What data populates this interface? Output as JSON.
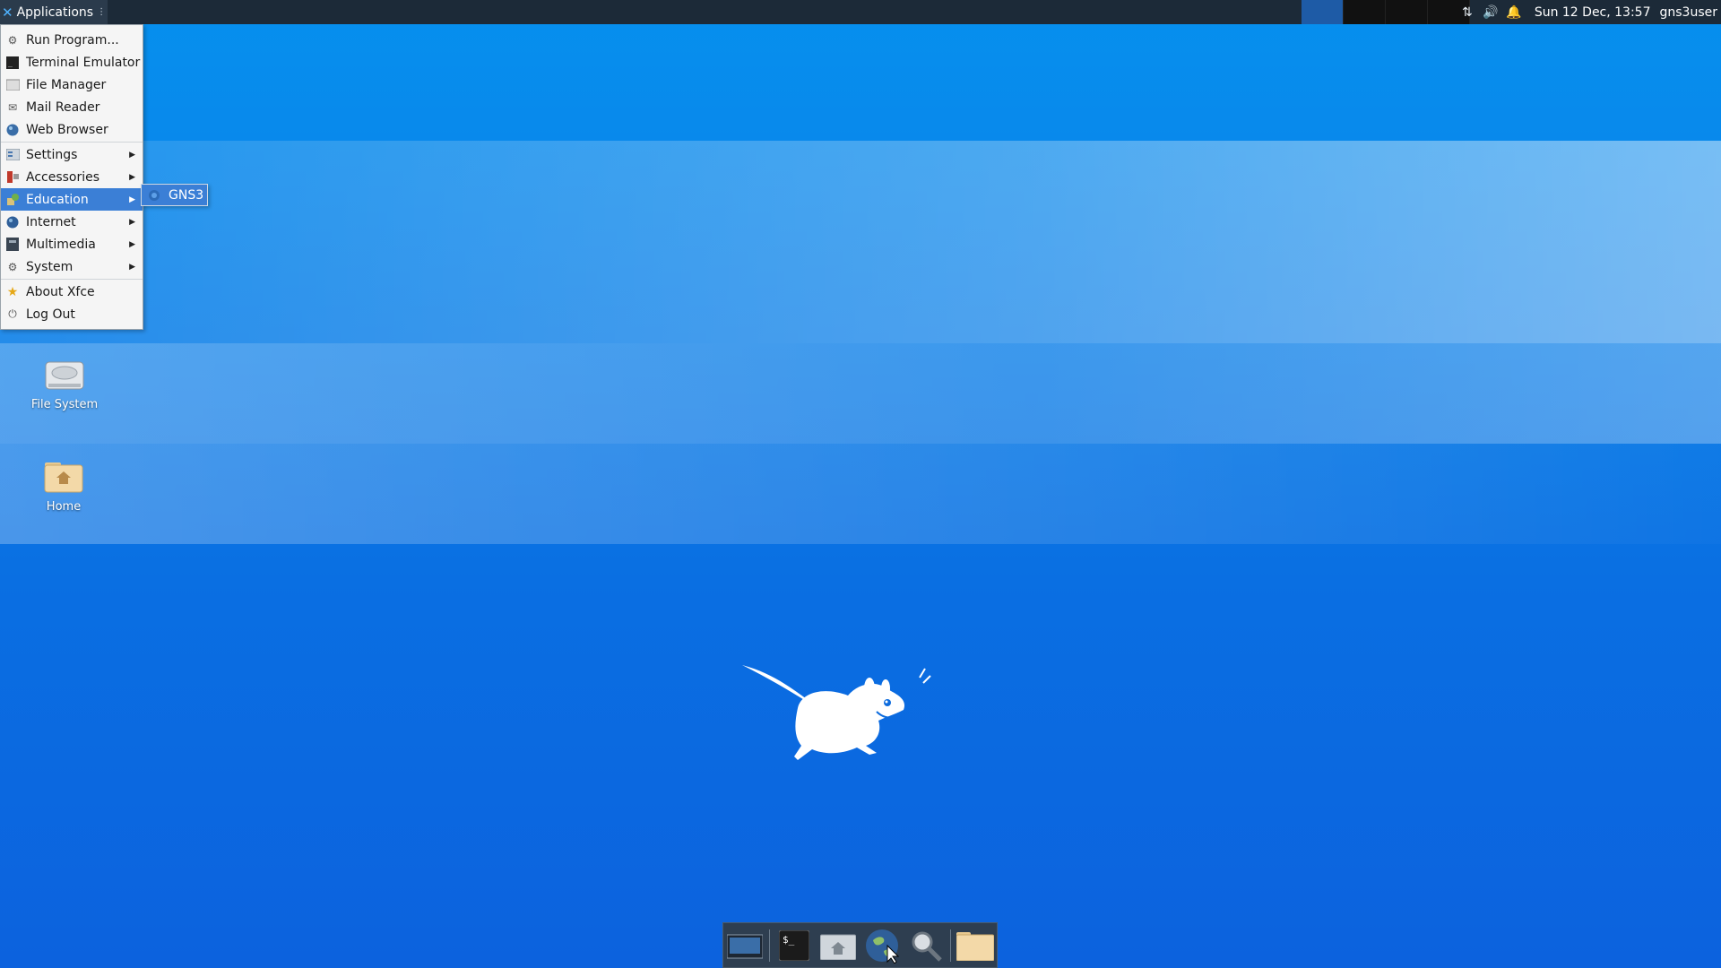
{
  "panel": {
    "apps_label": "Applications",
    "clock": "Sun 12 Dec, 13:57",
    "user": "gns3user",
    "tray_icons": [
      "network-icon",
      "volume-icon",
      "notification-bell-icon"
    ]
  },
  "menu": {
    "items": [
      {
        "label": "Run Program...",
        "icon": "run-icon"
      },
      {
        "label": "Terminal Emulator",
        "icon": "terminal-icon"
      },
      {
        "label": "File Manager",
        "icon": "file-manager-icon"
      },
      {
        "label": "Mail Reader",
        "icon": "mail-icon"
      },
      {
        "label": "Web Browser",
        "icon": "web-browser-icon"
      },
      {
        "label": "Settings",
        "icon": "settings-icon",
        "submenu": true
      },
      {
        "label": "Accessories",
        "icon": "accessories-icon",
        "submenu": true
      },
      {
        "label": "Education",
        "icon": "education-icon",
        "submenu": true,
        "selected": true
      },
      {
        "label": "Internet",
        "icon": "internet-icon",
        "submenu": true
      },
      {
        "label": "Multimedia",
        "icon": "multimedia-icon",
        "submenu": true
      },
      {
        "label": "System",
        "icon": "system-icon",
        "submenu": true
      },
      {
        "label": "About Xfce",
        "icon": "star-icon"
      },
      {
        "label": "Log Out",
        "icon": "power-icon"
      }
    ],
    "submenu_item": "GNS3"
  },
  "desktop": {
    "icons": [
      {
        "label": "File System"
      },
      {
        "label": "Home"
      }
    ]
  },
  "colors": {
    "accent": "#3b7fd6",
    "panel": "#1c2a38"
  }
}
